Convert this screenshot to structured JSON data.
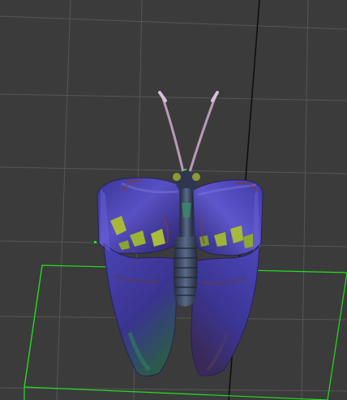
{
  "viewport": {
    "background_color": "#3b3b3b",
    "grid_color": "#565656",
    "axis_color": "#0b0b0b",
    "selection_color": "#22e01c"
  },
  "model": {
    "icon": "butterfly-icon",
    "wing_colors": [
      "#3e3aa6",
      "#5a52c8",
      "#2a2468",
      "#9fb23a",
      "#2e7a5a",
      "#8a3a2a"
    ],
    "body_color": "#3a4a66",
    "antenna_color": "#b89ab8"
  }
}
